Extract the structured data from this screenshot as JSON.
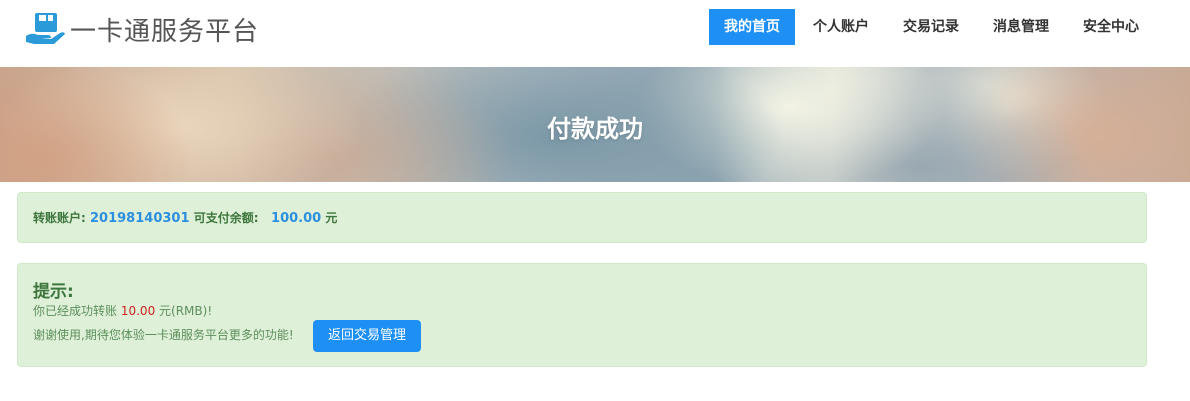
{
  "header": {
    "logo_text": "一卡通服务平台",
    "logo_icon": "hand-card-icon",
    "nav": [
      {
        "label": "我的首页",
        "active": true
      },
      {
        "label": "个人账户",
        "active": false
      },
      {
        "label": "交易记录",
        "active": false
      },
      {
        "label": "消息管理",
        "active": false
      },
      {
        "label": "安全中心",
        "active": false
      }
    ]
  },
  "banner": {
    "title": "付款成功"
  },
  "account": {
    "account_label": "转账账户:",
    "account_number": "20198140301",
    "balance_label": "可支付余额:",
    "balance_value": "100.00",
    "balance_unit": "元"
  },
  "tip": {
    "title": "提示:",
    "line1_prefix": "你已经成功转账",
    "amount": "10.00",
    "line1_suffix": "元(RMB)!",
    "line2": "谢谢使用,期待您体验一卡通服务平台更多的功能!",
    "button_label": "返回交易管理"
  },
  "colors": {
    "primary": "#1e90f5",
    "alert_bg": "#dff0d8",
    "alert_text": "#3c763d",
    "highlight_blue": "#2c8fe0",
    "highlight_red": "#d02020"
  }
}
